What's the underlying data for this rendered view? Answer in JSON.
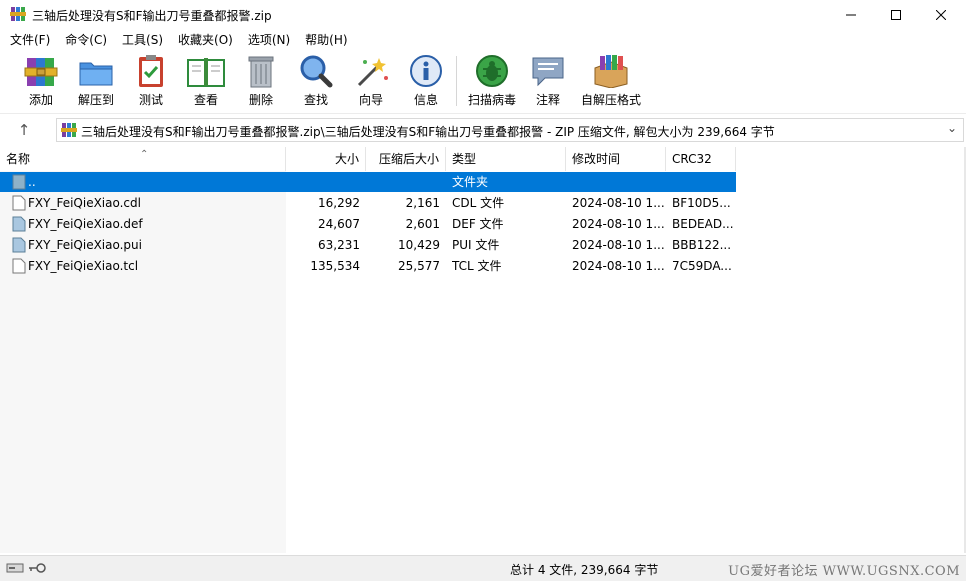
{
  "window": {
    "title": "三轴后处理没有S和F输出刀号重叠都报警.zip"
  },
  "menu": [
    "文件(F)",
    "命令(C)",
    "工具(S)",
    "收藏夹(O)",
    "选项(N)",
    "帮助(H)"
  ],
  "toolbar": {
    "add": "添加",
    "extract_to": "解压到",
    "test": "测试",
    "view": "查看",
    "delete": "删除",
    "find": "查找",
    "wizard": "向导",
    "info": "信息",
    "virus_scan": "扫描病毒",
    "comment": "注释",
    "sfx": "自解压格式"
  },
  "address": {
    "path": "三轴后处理没有S和F输出刀号重叠都报警.zip\\三轴后处理没有S和F输出刀号重叠都报警 - ZIP 压缩文件, 解包大小为 239,664 字节"
  },
  "columns": {
    "name": "名称",
    "size": "大小",
    "packed": "压缩后大小",
    "type": "类型",
    "modified": "修改时间",
    "crc": "CRC32"
  },
  "parent_row": {
    "name": "..",
    "type": "文件夹"
  },
  "files": [
    {
      "name": "FXY_FeiQieXiao.cdl",
      "size": "16,292",
      "packed": "2,161",
      "type": "CDL 文件",
      "modified": "2024-08-10 1...",
      "crc": "BF10D5..."
    },
    {
      "name": "FXY_FeiQieXiao.def",
      "size": "24,607",
      "packed": "2,601",
      "type": "DEF 文件",
      "modified": "2024-08-10 1...",
      "crc": "BEDEAD..."
    },
    {
      "name": "FXY_FeiQieXiao.pui",
      "size": "63,231",
      "packed": "10,429",
      "type": "PUI 文件",
      "modified": "2024-08-10 1...",
      "crc": "BBB122..."
    },
    {
      "name": "FXY_FeiQieXiao.tcl",
      "size": "135,534",
      "packed": "25,577",
      "type": "TCL 文件",
      "modified": "2024-08-10 1...",
      "crc": "7C59DA..."
    }
  ],
  "status": {
    "summary": "总计 4 文件, 239,664 字节",
    "watermark": "UG爱好者论坛 WWW.UGSNX.COM"
  }
}
